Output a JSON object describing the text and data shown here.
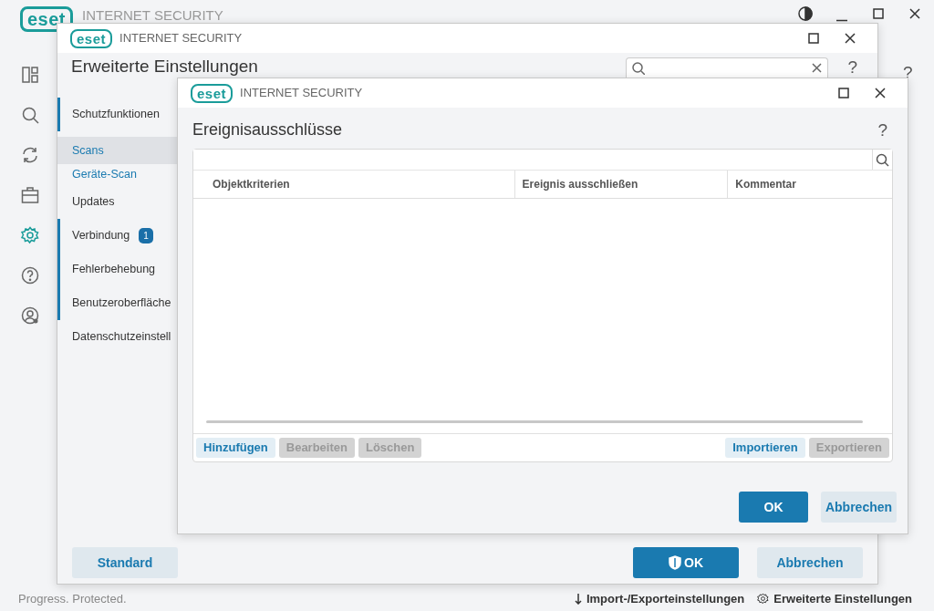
{
  "main_window": {
    "logo": "eset",
    "title": "INTERNET SECURITY",
    "nav": [
      {
        "selected": false
      },
      {
        "selected": false
      },
      {
        "selected": false
      },
      {
        "selected": false
      },
      {
        "selected": true
      },
      {
        "selected": false
      },
      {
        "selected": false
      }
    ],
    "help": "?",
    "footer": {
      "status": "Progress. Protected.",
      "links": [
        "Import-/Exporteinstellungen",
        "Erweiterte Einstellungen"
      ]
    }
  },
  "settings_dialog": {
    "logo": "eset",
    "title": "INTERNET SECURITY",
    "heading": "Erweiterte Einstellungen",
    "help": "?",
    "nav": [
      {
        "label": "Schutzfunktionen",
        "kind": "section",
        "marked": true,
        "selected": false
      },
      {
        "label": "Scans",
        "kind": "link",
        "marked": false,
        "selected": true
      },
      {
        "label": "Geräte-Scan",
        "kind": "link",
        "marked": false,
        "selected": false
      },
      {
        "label": "Updates",
        "kind": "section",
        "marked": false,
        "selected": false
      },
      {
        "label": "Verbindung",
        "kind": "section",
        "marked": true,
        "selected": false,
        "badge": "1"
      },
      {
        "label": "Fehlerbehebung",
        "kind": "section",
        "marked": true,
        "selected": false
      },
      {
        "label": "Benutzeroberfläche",
        "kind": "section",
        "marked": true,
        "selected": false
      },
      {
        "label": "Datenschutzeinstell",
        "kind": "section",
        "marked": false,
        "selected": false
      }
    ],
    "buttons": [
      {
        "label": "Standard",
        "kind": "secondary",
        "shield": false
      },
      {
        "label": "OK",
        "kind": "primary",
        "shield": true
      },
      {
        "label": "Abbrechen",
        "kind": "secondary",
        "shield": false
      }
    ]
  },
  "exclusions_dialog": {
    "logo": "eset",
    "title": "INTERNET SECURITY",
    "heading": "Ereignisausschlüsse",
    "help": "?",
    "table": {
      "columns": [
        "Objektkriterien",
        "Ereignis ausschließen",
        "Kommentar"
      ]
    },
    "toolbar_left": [
      {
        "label": "Hinzufügen",
        "disabled": false
      },
      {
        "label": "Bearbeiten",
        "disabled": true
      },
      {
        "label": "Löschen",
        "disabled": true
      }
    ],
    "toolbar_right": [
      {
        "label": "Importieren",
        "disabled": false
      },
      {
        "label": "Exportieren",
        "disabled": true
      }
    ],
    "buttons": [
      {
        "label": "OK",
        "kind": "primary"
      },
      {
        "label": "Abbrechen",
        "kind": "secondary"
      }
    ]
  }
}
